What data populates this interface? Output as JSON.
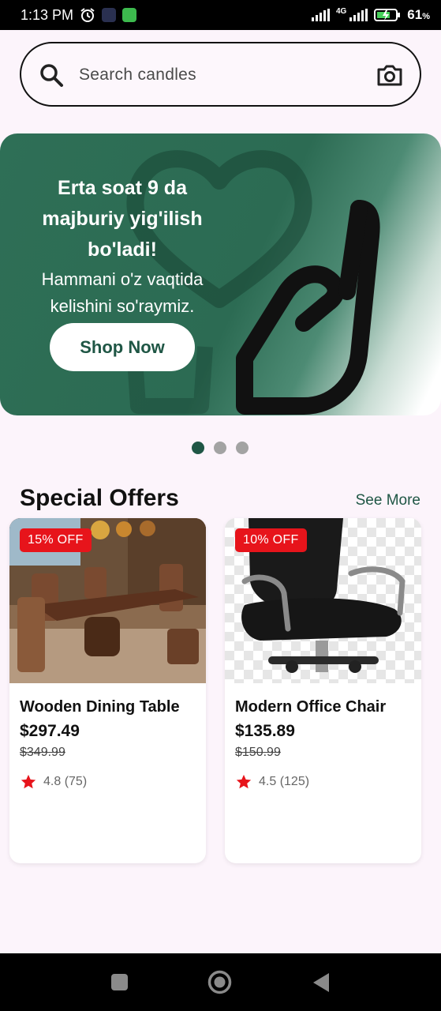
{
  "status_bar": {
    "time": "1:13 PM",
    "network": "4G",
    "battery": "61",
    "battery_unit": "%"
  },
  "search": {
    "placeholder": "Search candles"
  },
  "banner": {
    "title": "Erta soat 9 da majburiy yig'ilish bo'ladi!",
    "subtitle": "Hammani o'z vaqtida kelishini so'raymiz.",
    "button_label": "Shop Now",
    "accent_color": "#2e6f56"
  },
  "carousel": {
    "page_count": 3,
    "active_index": 0
  },
  "special_offers": {
    "title": "Special Offers",
    "see_more_label": "See More",
    "products": [
      {
        "discount": "15% OFF",
        "name": "Wooden Dining Table",
        "price": "$297.49",
        "old_price": "$349.99",
        "rating": "4.8 (75)"
      },
      {
        "discount": "10% OFF",
        "name": "Modern Office Chair",
        "price": "$135.89",
        "old_price": "$150.99",
        "rating": "4.5 (125)"
      }
    ]
  },
  "colors": {
    "primary": "#1f5645",
    "badge": "#e7141b",
    "star": "#e7141b"
  }
}
